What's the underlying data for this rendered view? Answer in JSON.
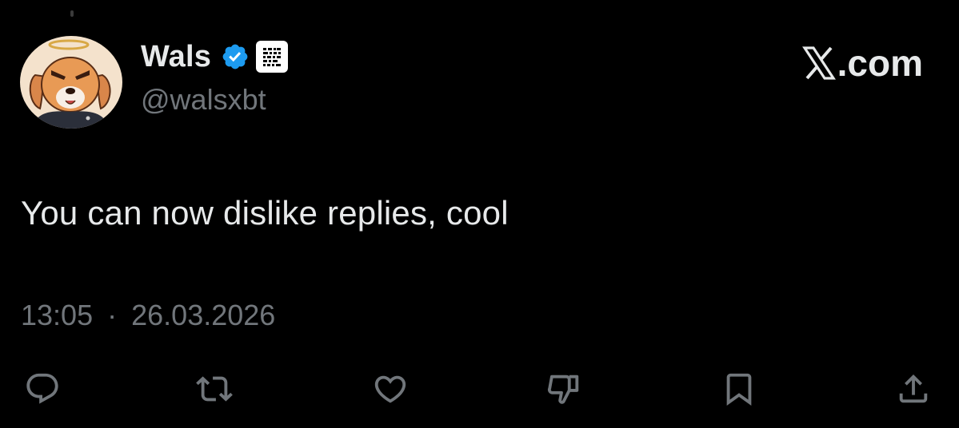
{
  "author": {
    "display_name": "Wals",
    "handle": "@walsxbt",
    "verified": true,
    "affiliate_badge_icon": "affiliate-qr-badge-icon"
  },
  "brand": {
    "label": ".com",
    "icon": "x-logo-icon"
  },
  "tweet": {
    "text": "You can now dislike replies, cool",
    "time": "13:05",
    "separator": "·",
    "date": "26.03.2026"
  },
  "actions": [
    {
      "name": "reply",
      "icon": "reply-icon"
    },
    {
      "name": "retweet",
      "icon": "retweet-icon"
    },
    {
      "name": "like",
      "icon": "heart-icon"
    },
    {
      "name": "dislike",
      "icon": "thumbs-down-icon"
    },
    {
      "name": "bookmark",
      "icon": "bookmark-icon"
    },
    {
      "name": "share",
      "icon": "share-icon"
    }
  ],
  "colors": {
    "background": "#000000",
    "text_primary": "#e7e9ea",
    "text_secondary": "#71767b",
    "verified_blue": "#1d9bf0",
    "icon_gray": "#71767b"
  }
}
